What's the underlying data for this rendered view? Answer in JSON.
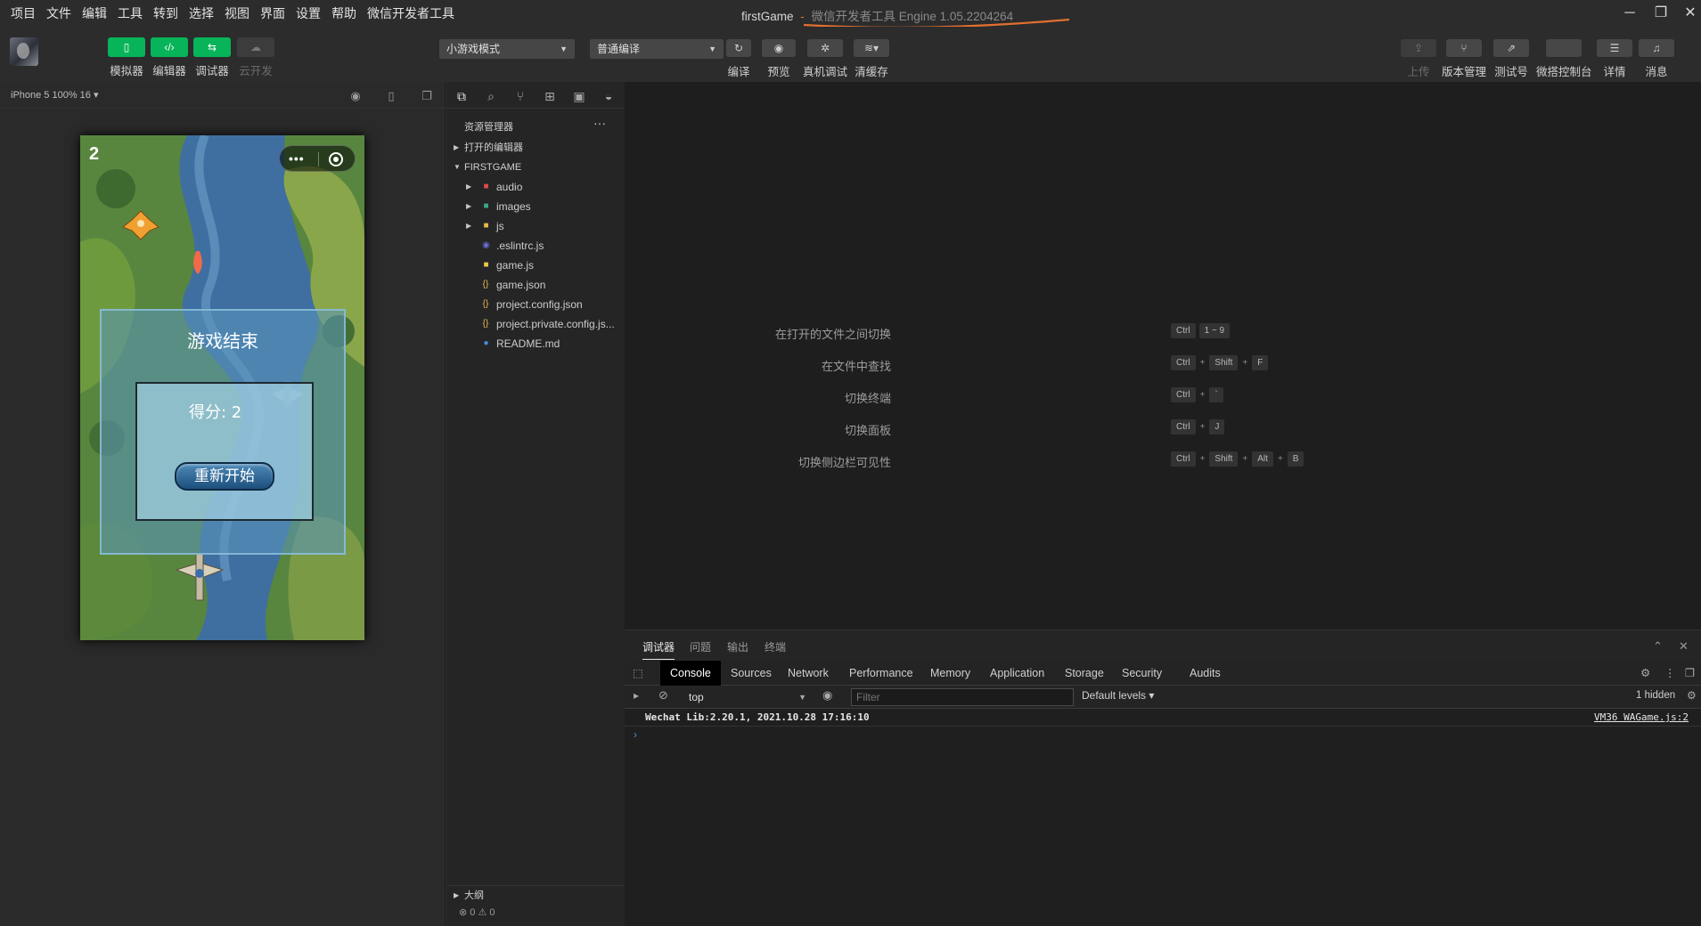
{
  "menu": [
    "项目",
    "文件",
    "编辑",
    "工具",
    "转到",
    "选择",
    "视图",
    "界面",
    "设置",
    "帮助",
    "微信开发者工具"
  ],
  "window": {
    "title": "firstGame",
    "separator": "-",
    "subtitle": "微信开发者工具 Engine 1.05.2204264",
    "minimize": "─",
    "restore": "❐",
    "close": "✕"
  },
  "toolbar": {
    "simulator": "模拟器",
    "editor": "编辑器",
    "debugger": "调试器",
    "cloud": "云开发",
    "mode_select": "小游戏模式",
    "compile_select": "普通编译",
    "compile": "编译",
    "preview": "预览",
    "remote_debug": "真机调试",
    "clear_cache": "清缓存",
    "upload": "上传",
    "version": "版本管理",
    "test": "测试号",
    "cloud_console": "微搭控制台",
    "details": "详情",
    "messages": "消息"
  },
  "simulator": {
    "device": "iPhone 5 100% 16 ▾",
    "game": {
      "score_top": "2",
      "capsule_dots": "•••",
      "game_over_title": "游戏结束",
      "score_text": "得分: 2",
      "restart": "重新开始"
    }
  },
  "explorer": {
    "title": "资源管理器",
    "more": "···",
    "open_editors": "打开的编辑器",
    "project": "FIRSTGAME",
    "items": [
      {
        "name": "audio",
        "icon": "folder-audio-icon",
        "folder": true
      },
      {
        "name": "images",
        "icon": "folder-images-icon",
        "folder": true
      },
      {
        "name": "js",
        "icon": "folder-icon",
        "folder": true
      },
      {
        "name": ".eslintrc.js",
        "icon": "eslint-icon",
        "folder": false
      },
      {
        "name": "game.js",
        "icon": "js-icon",
        "folder": false
      },
      {
        "name": "game.json",
        "icon": "json-icon",
        "folder": false
      },
      {
        "name": "project.config.json",
        "icon": "json-icon",
        "folder": false
      },
      {
        "name": "project.private.config.js...",
        "icon": "json-icon",
        "folder": false
      },
      {
        "name": "README.md",
        "icon": "info-icon",
        "folder": false
      }
    ],
    "outline": "大纲",
    "status": "⊗ 0 ⚠ 0"
  },
  "shortcuts": [
    {
      "label": "在打开的文件之间切换",
      "keys": [
        "Ctrl",
        "+",
        "1 ~ 9"
      ]
    },
    {
      "label": "在文件中查找",
      "keys": [
        "Ctrl",
        "+",
        "Shift",
        "+",
        "F"
      ]
    },
    {
      "label": "切换终端",
      "keys": [
        "Ctrl",
        "+",
        "`"
      ]
    },
    {
      "label": "切换面板",
      "keys": [
        "Ctrl",
        "+",
        "J"
      ]
    },
    {
      "label": "切换侧边栏可见性",
      "keys": [
        "Ctrl",
        "+",
        "Shift",
        "+",
        "Alt",
        "+",
        "B"
      ]
    }
  ],
  "debug": {
    "tabs": [
      "调试器",
      "问题",
      "输出",
      "终端"
    ],
    "devtools_tabs": [
      "Console",
      "Sources",
      "Network",
      "Performance",
      "Memory",
      "Application",
      "Storage",
      "Security",
      "Audits"
    ],
    "context": "top",
    "filter_placeholder": "Filter",
    "levels": "Default levels ▾",
    "hidden": "1 hidden",
    "log": "Wechat Lib:2.20.1, 2021.10.28 17:16:10",
    "log_source": "VM36 WAGame.js:2",
    "prompt": "›"
  },
  "colors": {
    "accent_green": "#07b45a",
    "annotation_orange": "#e07030",
    "prompt_blue": "#4a90e2"
  }
}
